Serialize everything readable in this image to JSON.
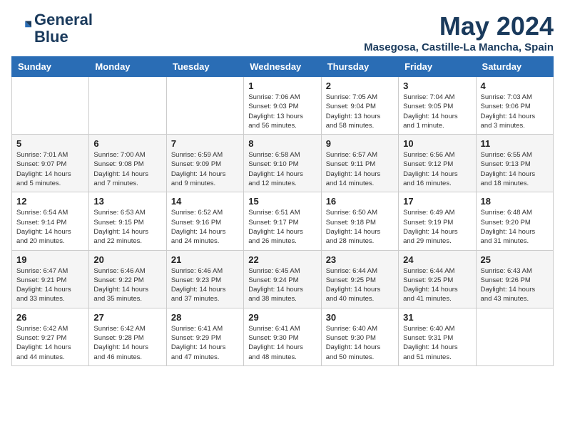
{
  "header": {
    "logo_line1": "General",
    "logo_line2": "Blue",
    "month": "May 2024",
    "location": "Masegosa, Castille-La Mancha, Spain"
  },
  "days_of_week": [
    "Sunday",
    "Monday",
    "Tuesday",
    "Wednesday",
    "Thursday",
    "Friday",
    "Saturday"
  ],
  "weeks": [
    [
      {
        "day": "",
        "info": ""
      },
      {
        "day": "",
        "info": ""
      },
      {
        "day": "",
        "info": ""
      },
      {
        "day": "1",
        "info": "Sunrise: 7:06 AM\nSunset: 9:03 PM\nDaylight: 13 hours\nand 56 minutes."
      },
      {
        "day": "2",
        "info": "Sunrise: 7:05 AM\nSunset: 9:04 PM\nDaylight: 13 hours\nand 58 minutes."
      },
      {
        "day": "3",
        "info": "Sunrise: 7:04 AM\nSunset: 9:05 PM\nDaylight: 14 hours\nand 1 minute."
      },
      {
        "day": "4",
        "info": "Sunrise: 7:03 AM\nSunset: 9:06 PM\nDaylight: 14 hours\nand 3 minutes."
      }
    ],
    [
      {
        "day": "5",
        "info": "Sunrise: 7:01 AM\nSunset: 9:07 PM\nDaylight: 14 hours\nand 5 minutes."
      },
      {
        "day": "6",
        "info": "Sunrise: 7:00 AM\nSunset: 9:08 PM\nDaylight: 14 hours\nand 7 minutes."
      },
      {
        "day": "7",
        "info": "Sunrise: 6:59 AM\nSunset: 9:09 PM\nDaylight: 14 hours\nand 9 minutes."
      },
      {
        "day": "8",
        "info": "Sunrise: 6:58 AM\nSunset: 9:10 PM\nDaylight: 14 hours\nand 12 minutes."
      },
      {
        "day": "9",
        "info": "Sunrise: 6:57 AM\nSunset: 9:11 PM\nDaylight: 14 hours\nand 14 minutes."
      },
      {
        "day": "10",
        "info": "Sunrise: 6:56 AM\nSunset: 9:12 PM\nDaylight: 14 hours\nand 16 minutes."
      },
      {
        "day": "11",
        "info": "Sunrise: 6:55 AM\nSunset: 9:13 PM\nDaylight: 14 hours\nand 18 minutes."
      }
    ],
    [
      {
        "day": "12",
        "info": "Sunrise: 6:54 AM\nSunset: 9:14 PM\nDaylight: 14 hours\nand 20 minutes."
      },
      {
        "day": "13",
        "info": "Sunrise: 6:53 AM\nSunset: 9:15 PM\nDaylight: 14 hours\nand 22 minutes."
      },
      {
        "day": "14",
        "info": "Sunrise: 6:52 AM\nSunset: 9:16 PM\nDaylight: 14 hours\nand 24 minutes."
      },
      {
        "day": "15",
        "info": "Sunrise: 6:51 AM\nSunset: 9:17 PM\nDaylight: 14 hours\nand 26 minutes."
      },
      {
        "day": "16",
        "info": "Sunrise: 6:50 AM\nSunset: 9:18 PM\nDaylight: 14 hours\nand 28 minutes."
      },
      {
        "day": "17",
        "info": "Sunrise: 6:49 AM\nSunset: 9:19 PM\nDaylight: 14 hours\nand 29 minutes."
      },
      {
        "day": "18",
        "info": "Sunrise: 6:48 AM\nSunset: 9:20 PM\nDaylight: 14 hours\nand 31 minutes."
      }
    ],
    [
      {
        "day": "19",
        "info": "Sunrise: 6:47 AM\nSunset: 9:21 PM\nDaylight: 14 hours\nand 33 minutes."
      },
      {
        "day": "20",
        "info": "Sunrise: 6:46 AM\nSunset: 9:22 PM\nDaylight: 14 hours\nand 35 minutes."
      },
      {
        "day": "21",
        "info": "Sunrise: 6:46 AM\nSunset: 9:23 PM\nDaylight: 14 hours\nand 37 minutes."
      },
      {
        "day": "22",
        "info": "Sunrise: 6:45 AM\nSunset: 9:24 PM\nDaylight: 14 hours\nand 38 minutes."
      },
      {
        "day": "23",
        "info": "Sunrise: 6:44 AM\nSunset: 9:25 PM\nDaylight: 14 hours\nand 40 minutes."
      },
      {
        "day": "24",
        "info": "Sunrise: 6:44 AM\nSunset: 9:25 PM\nDaylight: 14 hours\nand 41 minutes."
      },
      {
        "day": "25",
        "info": "Sunrise: 6:43 AM\nSunset: 9:26 PM\nDaylight: 14 hours\nand 43 minutes."
      }
    ],
    [
      {
        "day": "26",
        "info": "Sunrise: 6:42 AM\nSunset: 9:27 PM\nDaylight: 14 hours\nand 44 minutes."
      },
      {
        "day": "27",
        "info": "Sunrise: 6:42 AM\nSunset: 9:28 PM\nDaylight: 14 hours\nand 46 minutes."
      },
      {
        "day": "28",
        "info": "Sunrise: 6:41 AM\nSunset: 9:29 PM\nDaylight: 14 hours\nand 47 minutes."
      },
      {
        "day": "29",
        "info": "Sunrise: 6:41 AM\nSunset: 9:30 PM\nDaylight: 14 hours\nand 48 minutes."
      },
      {
        "day": "30",
        "info": "Sunrise: 6:40 AM\nSunset: 9:30 PM\nDaylight: 14 hours\nand 50 minutes."
      },
      {
        "day": "31",
        "info": "Sunrise: 6:40 AM\nSunset: 9:31 PM\nDaylight: 14 hours\nand 51 minutes."
      },
      {
        "day": "",
        "info": ""
      }
    ]
  ]
}
